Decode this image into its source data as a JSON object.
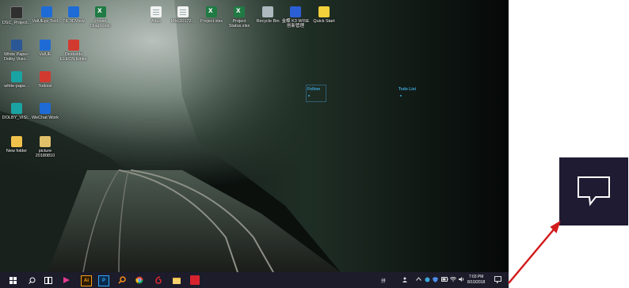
{
  "desktop_icons": [
    {
      "label": "DSC_Project...",
      "icon": "app-shortcut-icon"
    },
    {
      "label": "ValUEpc Tool...",
      "icon": "app-icon"
    },
    {
      "label": "TE 3DView",
      "icon": "app-icon"
    },
    {
      "label": "Power Diagnostic",
      "icon": "excel-icon"
    },
    {
      "label": "Alias",
      "icon": "document-icon"
    },
    {
      "label": "Mbc20172...",
      "icon": "shortcut-icon"
    },
    {
      "label": "Project.xlsx",
      "icon": "excel-icon"
    },
    {
      "label": "Project Status.xlsx",
      "icon": "excel-icon"
    },
    {
      "label": "Recycle Bin",
      "icon": "recycle-bin-icon"
    },
    {
      "label": "金蝶 K3 WISE 创新管理",
      "icon": "k3-icon"
    },
    {
      "label": "Quick Start",
      "icon": "quick-start-icon"
    },
    {
      "label": "White Paper-Dolby Visio...",
      "icon": "word-icon"
    },
    {
      "label": "ValUE",
      "icon": "value-icon"
    },
    {
      "label": "Deskside ELECN Editor",
      "icon": "editor-icon"
    },
    {
      "label": "white-pape...",
      "icon": "teal-app-icon"
    },
    {
      "label": "Todoist",
      "icon": "todoist-icon"
    },
    {
      "label": "DOLBY_VISI...",
      "icon": "image-icon"
    },
    {
      "label": "WeChat Work",
      "icon": "wechat-work-icon"
    },
    {
      "label": "New folder",
      "icon": "folder-icon"
    },
    {
      "label": "picture 20180810",
      "icon": "picture-icon"
    }
  ],
  "widgets": {
    "follow": "Follow",
    "todo": "Todo List"
  },
  "taskbar": {
    "apps": [
      "start-icon",
      "search-icon",
      "task-view-icon",
      "media-player-icon",
      "illustrator-icon",
      "photoshop-icon",
      "search-app-icon",
      "chrome-icon",
      "netease-music-icon",
      "file-explorer-icon",
      "red-app-icon"
    ],
    "tray_lang": "拼",
    "clock_time": "7:03 PM",
    "clock_date": "8/10/2018"
  },
  "colors": {
    "taskbar": "#1c1c2b",
    "callout_bg": "#1e1b33",
    "arrow": "#d21c1c",
    "widget_text": "#3da6d8"
  },
  "callout": {
    "icon": "action-center-icon"
  }
}
